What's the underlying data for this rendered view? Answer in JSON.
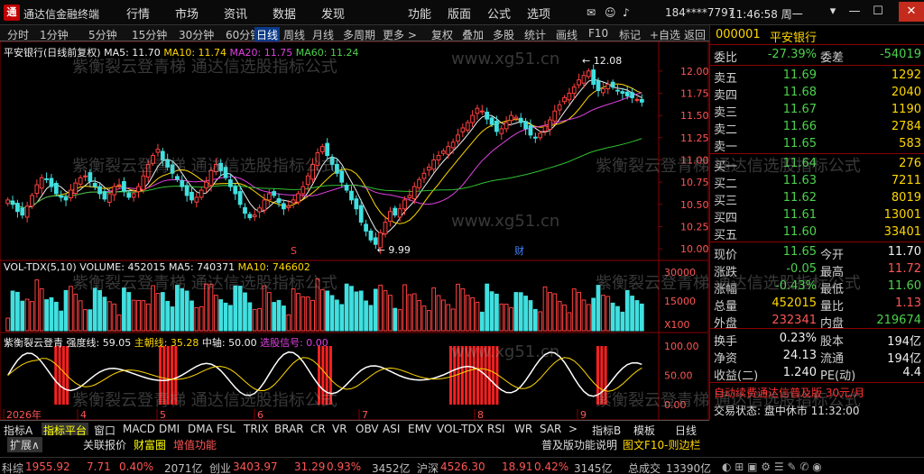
{
  "window": {
    "app_title": "通达信金融终端",
    "menus": [
      "行情",
      "市场",
      "资讯",
      "数据",
      "发现",
      "功能",
      "版面",
      "公式",
      "选项"
    ],
    "user": "184****7797",
    "clock": "11:46:58 周一"
  },
  "toolbar": {
    "items": [
      "分时",
      "1分钟",
      "5分钟",
      "15分钟",
      "30分钟",
      "60分钟",
      "日线",
      "周线",
      "月线",
      "多周期",
      "更多 >",
      "复权",
      "叠加",
      "多股",
      "统计",
      "画线",
      "F10",
      "标记",
      "+自选",
      "返回"
    ],
    "active": "日线"
  },
  "main_chart": {
    "header": "平安银行(日线前复权)",
    "ma5": "MA5: 11.70",
    "ma10": "MA10: 11.74",
    "ma20": "MA20: 11.75",
    "ma60": "MA60: 11.24",
    "high_label": "12.08",
    "low_label": "9.99",
    "marker_s": "S",
    "marker_cai": "财",
    "axis_labels": [
      "12.00",
      "11.75",
      "11.50",
      "11.25",
      "11.00",
      "10.75",
      "10.50",
      "10.25",
      "10.00"
    ]
  },
  "volume_chart": {
    "header": "VOL-TDX(5,10)",
    "volume": "VOLUME: 452015",
    "ma5": "MA5: 740371",
    "ma10": "MA10: 746602",
    "axis_labels": [
      "30000",
      "15000",
      "X100"
    ]
  },
  "indicator_chart": {
    "header": "紫衡裂云登青",
    "strength": "强度线: 59.05",
    "zhaozhao": "主朝线: 35.28",
    "zhongxian": "中轴: 50.00",
    "signal": "选股信号: 0.00",
    "axis_labels": [
      "100.00",
      "50.00",
      "0.00"
    ],
    "date_labels": [
      "2026年",
      "4",
      "5",
      "6",
      "7",
      "8",
      "9"
    ],
    "period_label": "日线"
  },
  "chart_data": {
    "type": "candlestick",
    "ylim": [
      9.9,
      12.15
    ],
    "close": [
      10.55,
      10.5,
      10.42,
      10.38,
      10.48,
      10.6,
      10.72,
      10.8,
      10.78,
      10.7,
      10.62,
      10.58,
      10.55,
      10.66,
      10.74,
      10.8,
      10.82,
      10.76,
      10.7,
      10.62,
      10.56,
      10.62,
      10.7,
      10.72,
      10.65,
      10.58,
      10.62,
      10.7,
      10.82,
      10.95,
      11.05,
      11.12,
      11.0,
      10.92,
      10.85,
      10.78,
      10.7,
      10.6,
      10.55,
      10.58,
      10.66,
      10.75,
      10.88,
      10.95,
      10.88,
      10.8,
      10.7,
      10.62,
      10.5,
      10.4,
      10.35,
      10.38,
      10.46,
      10.55,
      10.62,
      10.6,
      10.52,
      10.45,
      10.48,
      10.55,
      10.62,
      10.7,
      10.82,
      10.95,
      11.08,
      11.15,
      11.05,
      10.95,
      10.85,
      10.75,
      10.66,
      10.55,
      10.45,
      10.3,
      10.2,
      10.1,
      10.05,
      10.18,
      10.3,
      10.42,
      10.38,
      10.45,
      10.55,
      10.6,
      10.7,
      10.78,
      10.85,
      10.92,
      11.0,
      11.05,
      11.1,
      11.15,
      11.2,
      11.28,
      11.36,
      11.42,
      11.5,
      11.58,
      11.55,
      11.46,
      11.4,
      11.32,
      11.35,
      11.42,
      11.5,
      11.48,
      11.42,
      11.35,
      11.28,
      11.25,
      11.3,
      11.38,
      11.45,
      11.55,
      11.62,
      11.7,
      11.75,
      11.82,
      11.9,
      11.95,
      12.0,
      11.85,
      11.78,
      11.8,
      11.85,
      11.82,
      11.78,
      11.75,
      11.72,
      11.7,
      11.68,
      11.65
    ]
  },
  "quote_panel": {
    "code": "000001",
    "name": "平安银行",
    "webi_label": "委比",
    "webi_value": "-27.39%",
    "weicha_label": "委差",
    "weicha_value": "-54019",
    "asks": [
      {
        "label": "卖五",
        "price": "11.69",
        "vol": "1292"
      },
      {
        "label": "卖四",
        "price": "11.68",
        "vol": "2040"
      },
      {
        "label": "卖三",
        "price": "11.67",
        "vol": "1190"
      },
      {
        "label": "卖二",
        "price": "11.66",
        "vol": "2784"
      },
      {
        "label": "卖一",
        "price": "11.65",
        "vol": "583"
      }
    ],
    "bids": [
      {
        "label": "买一",
        "price": "11.64",
        "vol": "276"
      },
      {
        "label": "买二",
        "price": "11.63",
        "vol": "7211"
      },
      {
        "label": "买三",
        "price": "11.62",
        "vol": "8019"
      },
      {
        "label": "买四",
        "price": "11.61",
        "vol": "13001"
      },
      {
        "label": "买五",
        "price": "11.60",
        "vol": "33401"
      }
    ],
    "stats": [
      {
        "l1": "现价",
        "v1": "11.65",
        "l2": "今开",
        "v2": "11.70"
      },
      {
        "l1": "涨跌",
        "v1": "-0.05",
        "l2": "最高",
        "v2": "11.72"
      },
      {
        "l1": "涨幅",
        "v1": "-0.43%",
        "l2": "最低",
        "v2": "11.60"
      },
      {
        "l1": "总量",
        "v1": "452015",
        "l2": "量比",
        "v2": "1.13"
      },
      {
        "l1": "外盘",
        "v1": "232341",
        "l2": "内盘",
        "v2": "219674"
      }
    ],
    "fundamentals": [
      {
        "l1": "换手",
        "v1": "0.23%",
        "l2": "股本",
        "v2": "194亿"
      },
      {
        "l1": "净资",
        "v1": "24.13",
        "l2": "流通",
        "v2": "194亿"
      },
      {
        "l1": "收益(二)",
        "v1": "1.240",
        "l2": "PE(动)",
        "v2": "4.4"
      }
    ],
    "promo": "自动续费通达信普及版 30元/月",
    "trade_status": "交易状态: 盘中休市 11:32:00",
    "side_label": "笔"
  },
  "bottom_tabs": {
    "row1": [
      "指标A",
      "指标平台",
      "窗口",
      "MACD",
      "DMI",
      "DMA",
      "FSL",
      "TRIX",
      "BRAR",
      "CR",
      "VR",
      "OBV",
      "ASI",
      "EMV",
      "VOL-TDX",
      "RSI",
      "WR",
      "SAR",
      ">",
      "指标B",
      "模板"
    ],
    "active": "指标平台",
    "row2_expand": "扩展∧",
    "row2_items": [
      "关联报价",
      "财富圈",
      "增值功能"
    ],
    "help": "普及版功能说明",
    "f10": "图文F10-则边栏"
  },
  "status_bar": {
    "items": [
      {
        "label": "科综",
        "value": "1955.92",
        "change": "7.71",
        "pct": "0.40%",
        "amount": "2071亿"
      },
      {
        "label": "创业",
        "value": "3403.97",
        "change": "31.29",
        "pct": "0.93%",
        "amount": "3452亿"
      },
      {
        "label": "沪深",
        "value": "4526.30",
        "change": "18.91",
        "pct": "0.42%",
        "amount": "3145亿"
      }
    ],
    "total_label": "总成交",
    "total_value": "13390亿"
  },
  "watermark": {
    "text": "紫衡裂云登青梯 通达信选股指标公式",
    "url": "www.xg51.cn"
  }
}
